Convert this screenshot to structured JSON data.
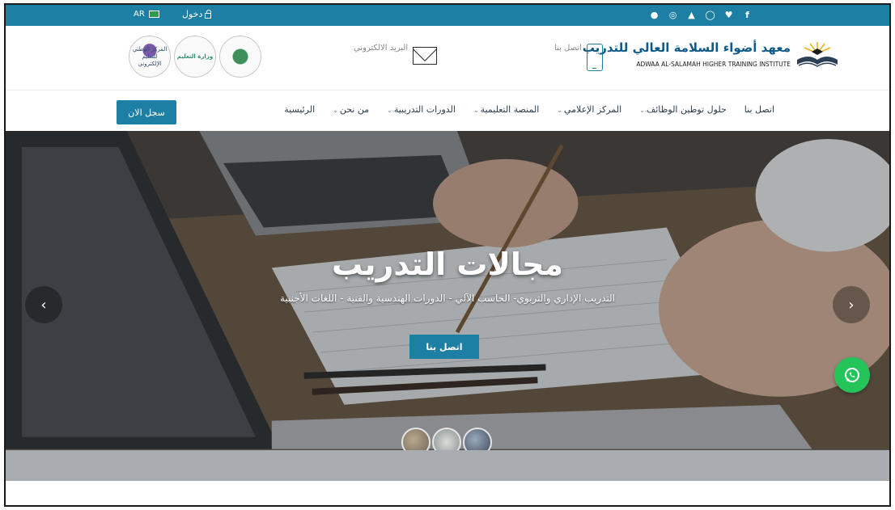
{
  "topbar": {
    "lang_label": "AR",
    "login_label": "دخول",
    "social_icons": [
      "user-icon",
      "instagram-icon",
      "youtube-icon",
      "whatsapp-icon",
      "twitter-icon",
      "facebook-icon"
    ],
    "social_glyphs": [
      "●",
      "◎",
      "▲",
      "◯",
      "♥",
      "f"
    ]
  },
  "header": {
    "email_label": "البريد الالكتروني",
    "phone_label": "اتصل بنا",
    "brand_ar": "معهد أضواء السلامة العالي للتدريب",
    "brand_en": "ADWAA AL-SALAMAH HIGHER TRAINING INSTITUTE",
    "partner_logos": [
      {
        "label": "المركز الوطني للتعليم الإلكتروني"
      },
      {
        "label": "وزارة التعليم"
      },
      {
        "label": ""
      }
    ]
  },
  "nav": {
    "items": [
      {
        "label": "الرئيسية",
        "dropdown": false
      },
      {
        "label": "من نحن",
        "dropdown": true
      },
      {
        "label": "الدورات التدريبية",
        "dropdown": true
      },
      {
        "label": "المنصة التعليمية",
        "dropdown": true
      },
      {
        "label": "المركز الإعلامي",
        "dropdown": true
      },
      {
        "label": "حلول توطين الوظائف",
        "dropdown": true
      },
      {
        "label": "اتصل بنا",
        "dropdown": false
      }
    ],
    "register_label": "سجل الان"
  },
  "hero": {
    "title": "مجالات التدريب",
    "subtitle": "التدريب الإداري والتربوي- الحاسب الآلي - الدورات الهندسية والفنية - اللغات الأجنبية",
    "cta_label": "اتصل بنا",
    "prev_glyph": "‹",
    "next_glyph": "›"
  },
  "colors": {
    "primary": "#1d7fa3",
    "whatsapp": "#25c45b"
  }
}
